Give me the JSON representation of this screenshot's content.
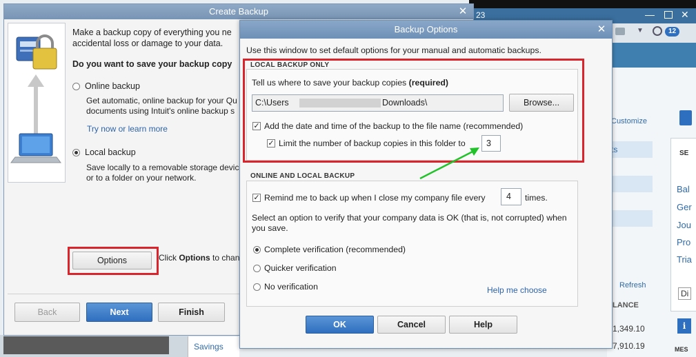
{
  "background_app": {
    "window_title_fragment": "23",
    "notification_count": "12",
    "customize_label": "Customize",
    "list_fragment": "ts",
    "refresh_label": "Refresh",
    "balance_header": "LANCE",
    "balance_rows": [
      "1,349.10",
      "7,910.19"
    ],
    "savings_label": "Savings",
    "right_panel_items": [
      "SE",
      "Bal",
      "Ger",
      "Jou",
      "Pro",
      "Tria",
      "Di"
    ],
    "right_panel_bottom": "MES"
  },
  "create_backup": {
    "title": "Create Backup",
    "intro_line1": "Make a backup copy of everything you ne",
    "intro_line2": "accidental loss or damage to your data.",
    "question": "Do you want to save your backup copy",
    "online_label": "Online backup",
    "online_desc1": "Get automatic, online backup for your Qu",
    "online_desc2": "documents using Intuit's online backup s",
    "try_link": "Try now or learn more",
    "local_label": "Local backup",
    "local_desc1": "Save locally to a removable storage devic",
    "local_desc2": "or to a folder on your network.",
    "options_button": "Options",
    "options_hint_pre": "Click ",
    "options_hint_bold": "Options",
    "options_hint_post": " to chan",
    "back_button": "Back",
    "next_button": "Next",
    "finish_button": "Finish",
    "selected": "local"
  },
  "backup_options": {
    "title": "Backup Options",
    "intro": "Use this window to set default options for your manual and automatic backups.",
    "local_group_title": "LOCAL BACKUP ONLY",
    "location_prompt": "Tell us where to save your backup copies ",
    "location_required": "(required)",
    "path_prefix": "C:\\Users",
    "path_suffix": "Downloads\\",
    "browse_button": "Browse...",
    "add_datetime_label": "Add the date and time of the backup to the file name (recommended)",
    "add_datetime_checked": true,
    "limit_label": "Limit the number of backup copies in this folder to",
    "limit_checked": true,
    "limit_value": "3",
    "online_local_group_title": "ONLINE AND LOCAL BACKUP",
    "remind_label": "Remind me to back up when I close my company file every",
    "remind_checked": true,
    "remind_value": "4",
    "remind_suffix": "times.",
    "verify_text1": "Select an option to verify that your company data is OK (that is, not corrupted) when",
    "verify_text2": "you save.",
    "verify_options": [
      "Complete verification (recommended)",
      "Quicker verification",
      "No verification"
    ],
    "verify_selected": 0,
    "help_link": "Help me choose",
    "ok_button": "OK",
    "cancel_button": "Cancel",
    "help_button": "Help"
  },
  "colors": {
    "highlight_red": "#d9242b",
    "arrow_green": "#22c22a",
    "primary_blue": "#2f6fbf"
  }
}
